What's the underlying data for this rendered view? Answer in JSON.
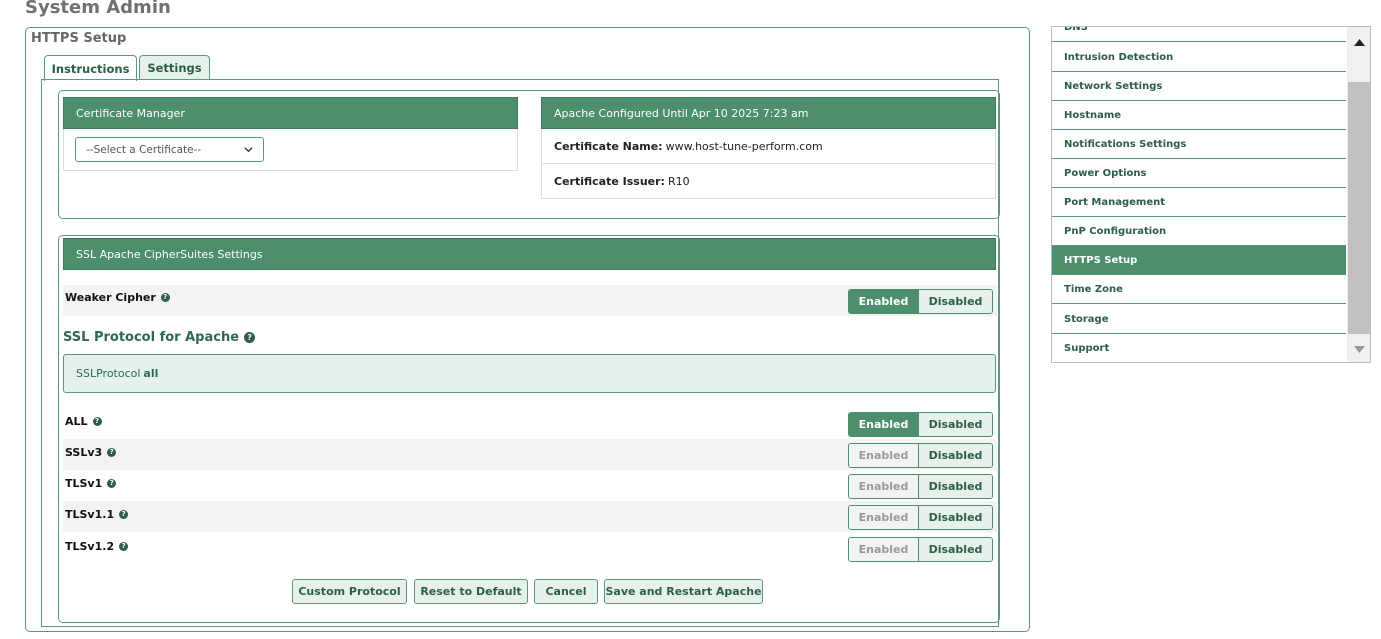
{
  "page_title": "System Admin",
  "panel_title": "HTTPS Setup",
  "tabs": [
    {
      "label": "Instructions",
      "active": false
    },
    {
      "label": "Settings",
      "active": true
    }
  ],
  "cert_manager": {
    "title": "Certificate Manager",
    "select_value": "--Select a Certificate--"
  },
  "apache": {
    "title": "Apache Configured Until Apr 10 2025 7:23 am",
    "cert_name_label": "Certificate Name:",
    "cert_name_value": "www.host-tune-perform.com",
    "cert_issuer_label": "Certificate Issuer:",
    "cert_issuer_value": "R10"
  },
  "ssl": {
    "title": "SSL Apache CipherSuites Settings",
    "weaker_cipher": {
      "label": "Weaker Cipher",
      "enabled": "Enabled",
      "disabled": "Disabled",
      "state": "enabled"
    },
    "protocol_title": "SSL Protocol for Apache",
    "protocol_info_key": "SSLProtocol",
    "protocol_info_value": "all",
    "protocols": [
      {
        "label": "ALL",
        "enabled": "Enabled",
        "disabled": "Disabled",
        "state": "enabled"
      },
      {
        "label": "SSLv3",
        "enabled": "Enabled",
        "disabled": "Disabled",
        "state": "disabled"
      },
      {
        "label": "TLSv1",
        "enabled": "Enabled",
        "disabled": "Disabled",
        "state": "disabled"
      },
      {
        "label": "TLSv1.1",
        "enabled": "Enabled",
        "disabled": "Disabled",
        "state": "disabled"
      },
      {
        "label": "TLSv1.2",
        "enabled": "Enabled",
        "disabled": "Disabled",
        "state": "disabled"
      }
    ]
  },
  "buttons": {
    "custom": "Custom Protocol",
    "reset": "Reset to Default",
    "cancel": "Cancel",
    "save": "Save and Restart Apache"
  },
  "sidebar": {
    "items": [
      {
        "label": "DNS",
        "active": false
      },
      {
        "label": "Intrusion Detection",
        "active": false
      },
      {
        "label": "Network Settings",
        "active": false
      },
      {
        "label": "Hostname",
        "active": false
      },
      {
        "label": "Notifications Settings",
        "active": false
      },
      {
        "label": "Power Options",
        "active": false
      },
      {
        "label": "Port Management",
        "active": false
      },
      {
        "label": "PnP Configuration",
        "active": false
      },
      {
        "label": "HTTPS Setup",
        "active": true
      },
      {
        "label": "Time Zone",
        "active": false
      },
      {
        "label": "Storage",
        "active": false
      },
      {
        "label": "Support",
        "active": false
      }
    ]
  },
  "icons": {
    "help": "question-circle-icon",
    "select_chevron": "chevron-down-icon",
    "scroll_up": "triangle-up-icon",
    "scroll_down": "triangle-down-icon"
  },
  "colors": {
    "accent": "#4d8e6d",
    "accent_dark": "#2d5e46",
    "info_bg": "#e4f1ee"
  }
}
